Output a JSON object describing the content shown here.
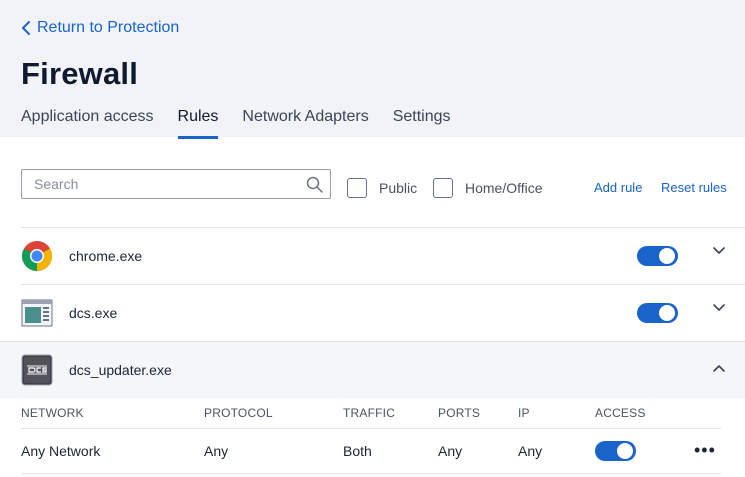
{
  "header": {
    "back_label": "Return to Protection",
    "title": "Firewall",
    "tabs": [
      {
        "label": "Application access",
        "active": false
      },
      {
        "label": "Rules",
        "active": true
      },
      {
        "label": "Network Adapters",
        "active": false
      },
      {
        "label": "Settings",
        "active": false
      }
    ]
  },
  "toolbar": {
    "search_placeholder": "Search",
    "filters": [
      {
        "label": "Public",
        "checked": false
      },
      {
        "label": "Home/Office",
        "checked": false
      }
    ],
    "add_rule_label": "Add rule",
    "reset_rules_label": "Reset rules"
  },
  "apps": [
    {
      "name": "chrome.exe",
      "icon": "chrome-icon",
      "enabled": true,
      "expanded": false
    },
    {
      "name": "dcs.exe",
      "icon": "dcs-app-icon",
      "enabled": true,
      "expanded": false
    },
    {
      "name": "dcs_updater.exe",
      "icon": "dcs-updater-icon",
      "enabled": null,
      "expanded": true
    }
  ],
  "rule_table": {
    "columns": [
      "NETWORK",
      "PROTOCOL",
      "TRAFFIC",
      "PORTS",
      "IP",
      "ACCESS"
    ],
    "rows": [
      {
        "network": "Any Network",
        "protocol": "Any",
        "traffic": "Both",
        "ports": "Any",
        "ip": "Any",
        "access": true
      }
    ]
  },
  "colors": {
    "accent": "#1a63c9",
    "header_bg": "#f1f3f9",
    "title": "#10192e"
  }
}
